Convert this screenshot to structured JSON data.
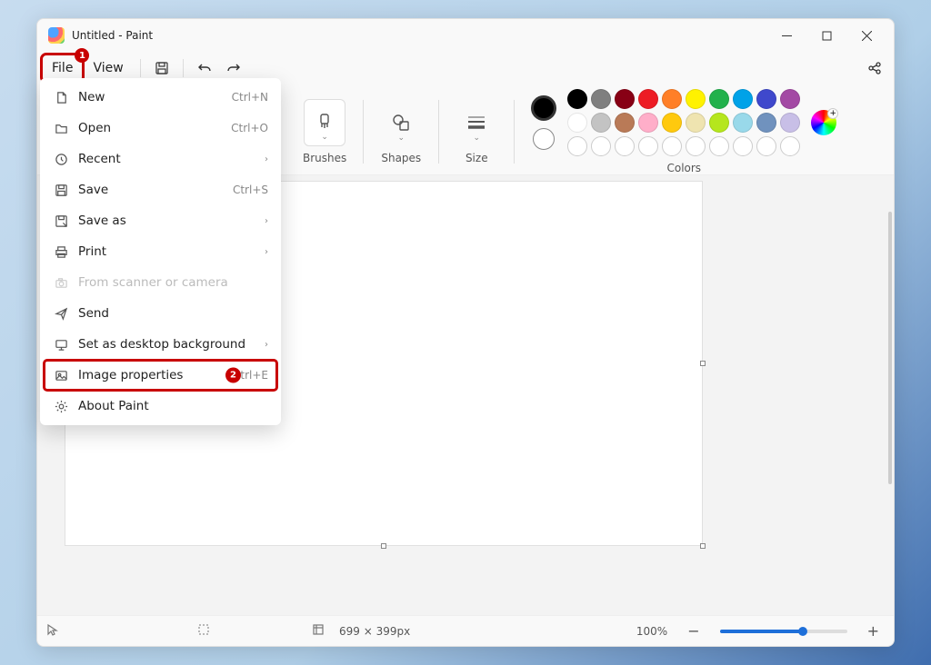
{
  "window": {
    "title": "Untitled - Paint"
  },
  "menu": {
    "file": "File",
    "view": "View"
  },
  "ribbon": {
    "brushes": "Brushes",
    "shapes": "Shapes",
    "size": "Size",
    "colors": "Colors"
  },
  "file_menu": {
    "items": [
      {
        "label": "New",
        "shortcut": "Ctrl+N",
        "icon": "doc",
        "type": "shortcut"
      },
      {
        "label": "Open",
        "shortcut": "Ctrl+O",
        "icon": "folder",
        "type": "shortcut"
      },
      {
        "label": "Recent",
        "icon": "clock",
        "type": "submenu"
      },
      {
        "label": "Save",
        "shortcut": "Ctrl+S",
        "icon": "save",
        "type": "shortcut"
      },
      {
        "label": "Save as",
        "icon": "saveas",
        "type": "submenu"
      },
      {
        "label": "Print",
        "icon": "print",
        "type": "submenu"
      },
      {
        "label": "From scanner or camera",
        "icon": "camera",
        "type": "plain",
        "disabled": true
      },
      {
        "label": "Send",
        "icon": "send",
        "type": "plain"
      },
      {
        "label": "Set as desktop background",
        "icon": "desktop",
        "type": "submenu"
      },
      {
        "label": "Image properties",
        "shortcut": "Ctrl+E",
        "icon": "image",
        "type": "shortcut",
        "highlight": true,
        "badge": "2"
      },
      {
        "label": "About Paint",
        "icon": "gear",
        "type": "plain"
      }
    ]
  },
  "palette_row1": [
    "#000000",
    "#7f7f7f",
    "#880015",
    "#ed1c24",
    "#ff7f27",
    "#fff200",
    "#22b14c",
    "#00a2e8",
    "#3f48cc",
    "#a349a4"
  ],
  "palette_row2": [
    "#ffffff",
    "#c3c3c3",
    "#b97a57",
    "#ffaec9",
    "#ffc90e",
    "#efe4b0",
    "#b5e61d",
    "#99d9ea",
    "#7092be",
    "#c8bfe7"
  ],
  "status": {
    "dimensions": "699 × 399px",
    "zoom": "100%"
  },
  "annotations": {
    "file_badge": "1"
  }
}
